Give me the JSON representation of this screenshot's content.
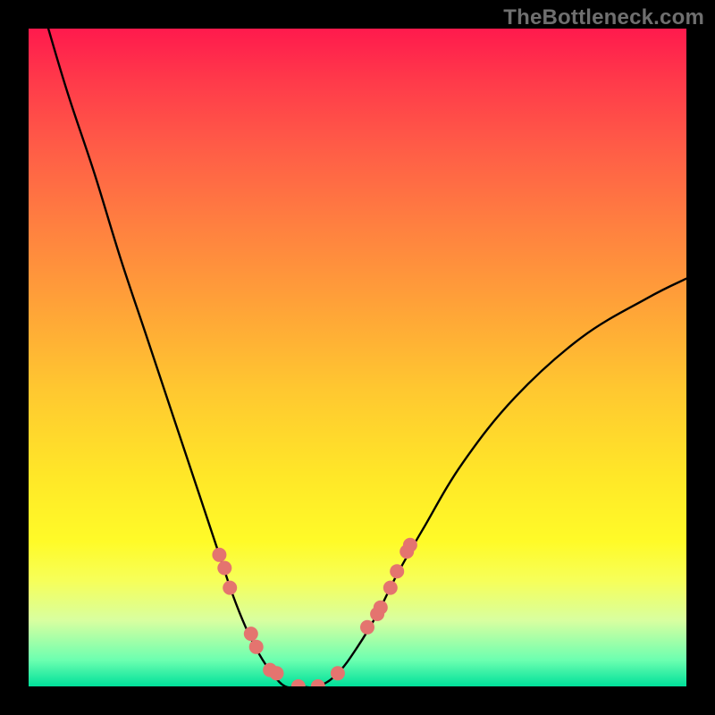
{
  "watermark": "TheBottleneck.com",
  "colors": {
    "curve": "#000000",
    "marker": "#e4746f",
    "background_black": "#000000"
  },
  "chart_data": {
    "type": "line",
    "title": "",
    "xlabel": "",
    "ylabel": "",
    "xlim": [
      0,
      100
    ],
    "ylim": [
      0,
      100
    ],
    "grid": false,
    "series": [
      {
        "name": "bottleneck-curve",
        "x": [
          3,
          6,
          10,
          14,
          18,
          22,
          26,
          29,
          31,
          33,
          35,
          37,
          39,
          41,
          44,
          47,
          50,
          53,
          56,
          60,
          66,
          74,
          84,
          94,
          100
        ],
        "y": [
          100,
          90,
          78,
          65,
          53,
          41,
          29,
          20,
          14,
          9,
          5,
          2,
          0,
          0,
          0,
          2,
          6,
          11,
          17,
          24,
          34,
          44,
          53,
          59,
          62
        ]
      }
    ],
    "markers": {
      "name": "highlight-dots",
      "x": [
        29.0,
        29.8,
        30.6,
        33.8,
        34.6,
        36.7,
        37.7,
        41.0,
        44.0,
        47.0,
        51.5,
        53.0,
        53.5,
        55.0,
        56.0,
        57.5,
        58.0
      ],
      "y": [
        20.0,
        18.0,
        15.0,
        8.0,
        6.0,
        2.5,
        2.0,
        0.0,
        0.0,
        2.0,
        9.0,
        11.0,
        12.0,
        15.0,
        17.5,
        20.5,
        21.5
      ]
    }
  }
}
